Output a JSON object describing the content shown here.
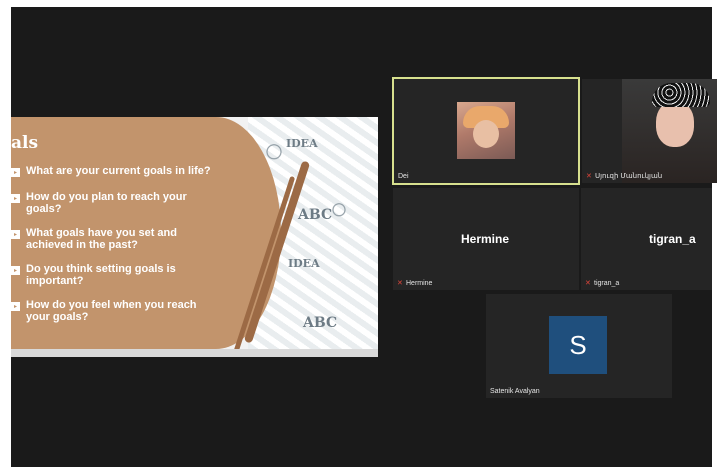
{
  "slide": {
    "title_fragment": "als",
    "questions": [
      "What are your current goals in life?",
      "How do you plan to reach your\ngoals?",
      "What goals have you set and\nachieved in the past?",
      "Do you think setting goals is\nimportant?",
      "How do you feel when you reach\nyour goals?"
    ],
    "doodle_words": [
      "IDEA",
      "ABC",
      "IDEA",
      "ABC"
    ]
  },
  "participants": [
    {
      "name": "Dei",
      "muted": false,
      "active_speaker": true,
      "video": "photo"
    },
    {
      "name": "Սյուզի Մանուկյան",
      "muted": true,
      "active_speaker": false,
      "video": "camera"
    },
    {
      "name": "Hermine",
      "display_name": "Hermine",
      "muted": true,
      "video": "off"
    },
    {
      "name": "tigran_a",
      "display_name": "tigran_a",
      "muted": true,
      "video": "off"
    },
    {
      "name": "Satenik Avalyan",
      "initial": "S",
      "muted": false,
      "video": "off",
      "avatar_color": "#1f4f7d"
    }
  ],
  "colors": {
    "slide_tan": "#c2946c",
    "active_border": "#d7e08e",
    "mute_icon": "#e0453a"
  }
}
